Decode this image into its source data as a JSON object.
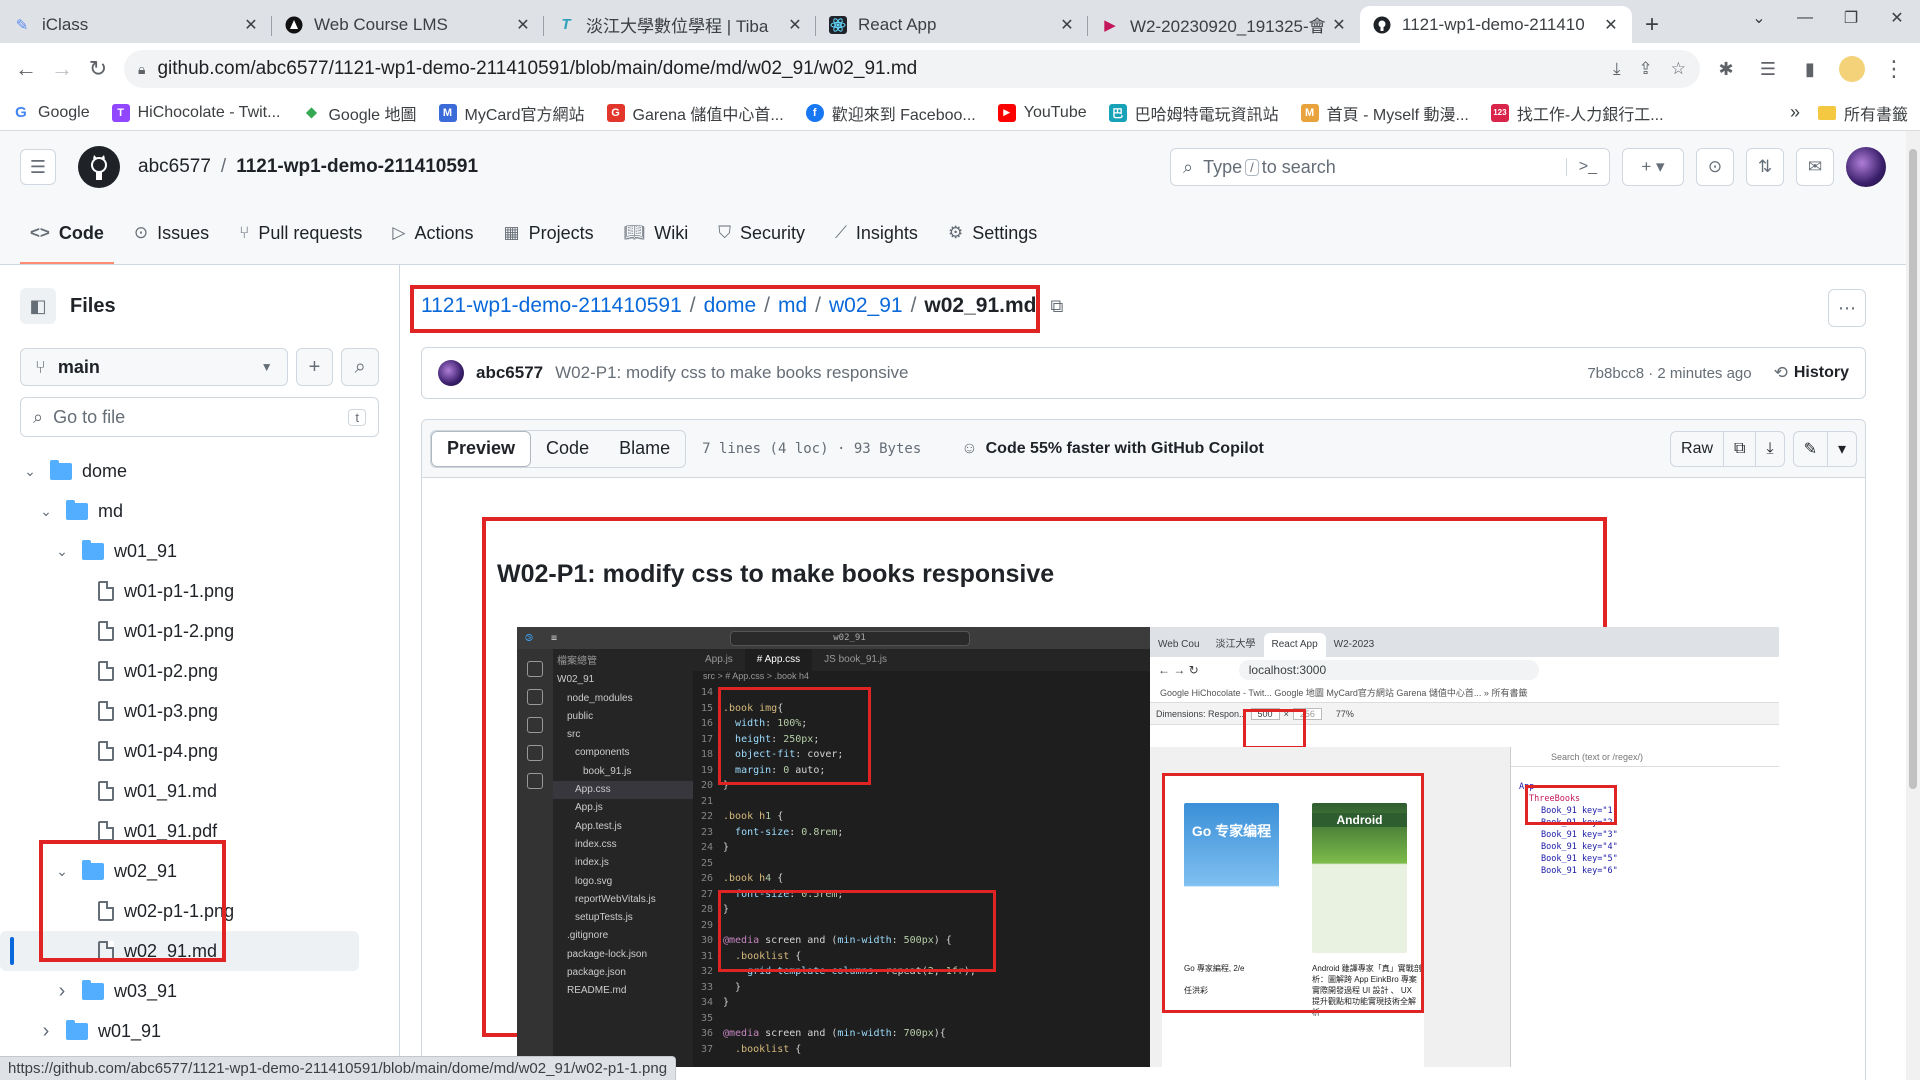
{
  "browser": {
    "tabs": [
      {
        "title": "iClass",
        "icon": "iclass-icon"
      },
      {
        "title": "Web Course LMS",
        "icon": "lms-icon"
      },
      {
        "title": "淡江大學數位學程 | Tiba",
        "icon": "tiba-icon"
      },
      {
        "title": "React App",
        "icon": "react-icon"
      },
      {
        "title": "W2-20230920_191325-會",
        "icon": "video-icon"
      },
      {
        "title": "1121-wp1-demo-211410",
        "icon": "github-icon"
      }
    ],
    "url": "github.com/abc6577/1121-wp1-demo-211410591/blob/main/dome/md/w02_91/w02_91.md",
    "bookmarks": [
      {
        "label": "Google",
        "color": "#4285f4",
        "glyph": "G"
      },
      {
        "label": "HiChocolate - Twit...",
        "color": "#9146ff",
        "glyph": "T"
      },
      {
        "label": "Google 地圖",
        "color": "#34a853",
        "glyph": "◆"
      },
      {
        "label": "MyCard官方網站",
        "color": "#3b6bd8",
        "glyph": "M"
      },
      {
        "label": "Garena 儲值中心首...",
        "color": "#e2352b",
        "glyph": "G"
      },
      {
        "label": "歡迎來到 Faceboo...",
        "color": "#1877f2",
        "glyph": "f"
      },
      {
        "label": "YouTube",
        "color": "#ff0000",
        "glyph": "▶"
      },
      {
        "label": "巴哈姆特電玩資訊站",
        "color": "#18a2b8",
        "glyph": "巴"
      },
      {
        "label": "首頁 - Myself 動漫...",
        "color": "#e8a33c",
        "glyph": "M"
      },
      {
        "label": "找工作-人力銀行工...",
        "color": "#d9254a",
        "glyph": "123"
      }
    ],
    "bookmarks_all": "所有書籤",
    "status_url": "https://github.com/abc6577/1121-wp1-demo-211410591/blob/main/dome/md/w02_91/w02-p1-1.png"
  },
  "github": {
    "owner": "abc6577",
    "repo": "1121-wp1-demo-211410591",
    "search_placeholder": "Type / to search",
    "search_prefix": "Type",
    "search_slash": "/",
    "search_suffix": "to search",
    "nav": [
      "Code",
      "Issues",
      "Pull requests",
      "Actions",
      "Projects",
      "Wiki",
      "Security",
      "Insights",
      "Settings"
    ],
    "files_title": "Files",
    "branch": "main",
    "goto_placeholder": "Go to file",
    "goto_key": "t",
    "tree": [
      {
        "label": "dome",
        "type": "folder",
        "depth": 0,
        "open": true
      },
      {
        "label": "md",
        "type": "folder",
        "depth": 1,
        "open": true
      },
      {
        "label": "w01_91",
        "type": "folder",
        "depth": 2,
        "open": true
      },
      {
        "label": "w01-p1-1.png",
        "type": "file",
        "depth": 3
      },
      {
        "label": "w01-p1-2.png",
        "type": "file",
        "depth": 3
      },
      {
        "label": "w01-p2.png",
        "type": "file",
        "depth": 3
      },
      {
        "label": "w01-p3.png",
        "type": "file",
        "depth": 3
      },
      {
        "label": "w01-p4.png",
        "type": "file",
        "depth": 3
      },
      {
        "label": "w01_91.md",
        "type": "file",
        "depth": 3
      },
      {
        "label": "w01_91.pdf",
        "type": "file",
        "depth": 3
      },
      {
        "label": "w02_91",
        "type": "folder",
        "depth": 2,
        "open": true
      },
      {
        "label": "w02-p1-1.png",
        "type": "file",
        "depth": 3
      },
      {
        "label": "w02_91.md",
        "type": "file",
        "depth": 3,
        "selected": true
      },
      {
        "label": "w03_91",
        "type": "folder",
        "depth": 2,
        "open": false
      },
      {
        "label": "w01_91",
        "type": "folder",
        "depth": 1,
        "open": false
      }
    ],
    "path": {
      "repo": "1121-wp1-demo-211410591",
      "parts": [
        "dome",
        "md",
        "w02_91"
      ],
      "file": "w02_91.md"
    },
    "commit": {
      "author": "abc6577",
      "message": "W02-P1: modify css to make books responsive",
      "sha_time": "7b8bcc8 · 2 minutes ago",
      "history": "History"
    },
    "file_header": {
      "tabs": [
        "Preview",
        "Code",
        "Blame"
      ],
      "meta": "7 lines (4 loc) · 93 Bytes",
      "copilot": "Code 55% faster with GitHub Copilot",
      "raw": "Raw"
    },
    "md_title": "W02-P1: modify css to make books responsive"
  },
  "embedded": {
    "vscode_search": "w02_91",
    "explorer": [
      "檔案總管",
      "W02_91",
      "node_modules",
      "public",
      "src",
      "components",
      "book_91.js",
      "App.css",
      "App.js",
      "App.test.js",
      "index.css",
      "index.js",
      "logo.svg",
      "reportWebVitals.js",
      "setupTests.js",
      ".gitignore",
      "package-lock.json",
      "package.json",
      "README.md"
    ],
    "editor_tabs": [
      "App.js",
      "# App.css",
      "JS book_91.js"
    ],
    "editor_crumb": "src > # App.css > .book h4",
    "code": [
      {
        "n": "14",
        "t": ""
      },
      {
        "n": "15",
        "t": ".book img{"
      },
      {
        "n": "16",
        "t": "  width: 100%;"
      },
      {
        "n": "17",
        "t": "  height: 250px;"
      },
      {
        "n": "18",
        "t": "  object-fit: cover;"
      },
      {
        "n": "19",
        "t": "  margin: 0 auto;"
      },
      {
        "n": "20",
        "t": "}"
      },
      {
        "n": "21",
        "t": ""
      },
      {
        "n": "22",
        "t": ".book h1 {"
      },
      {
        "n": "23",
        "t": "  font-size: 0.8rem;"
      },
      {
        "n": "24",
        "t": "}"
      },
      {
        "n": "25",
        "t": ""
      },
      {
        "n": "26",
        "t": ".book h4 {"
      },
      {
        "n": "27",
        "t": "  font-size: 0.5rem;"
      },
      {
        "n": "28",
        "t": "}"
      },
      {
        "n": "29",
        "t": ""
      },
      {
        "n": "30",
        "t": "@media screen and (min-width: 500px) {"
      },
      {
        "n": "31",
        "t": "  .booklist {"
      },
      {
        "n": "32",
        "t": "    grid-template-columns: repeat(2, 1fr);"
      },
      {
        "n": "33",
        "t": "  }"
      },
      {
        "n": "34",
        "t": "}"
      },
      {
        "n": "35",
        "t": ""
      },
      {
        "n": "36",
        "t": "@media screen and (min-width: 700px){"
      },
      {
        "n": "37",
        "t": "  .booklist {"
      }
    ],
    "browser_tabs": [
      "Web Cou",
      "淡江大學",
      "React App",
      "W2-2023"
    ],
    "browser_url": "localhost:3000",
    "browser_bookmarks": "Google   HiChocolate - Twit...   Google 地圖   MyCard官方網站   Garena 儲值中心首...   »   所有書籤",
    "dimensions_label": "Dimensions: Respon...",
    "width": "500",
    "height": "256",
    "zoom": "77%",
    "devtools_search": "Search (text or /regex/)",
    "devtools_app": "App",
    "devtools_nodes": [
      "ThreeBooks",
      "Book_91 key=\"1\"",
      "Book_91 key=\"2\"",
      "Book_91 key=\"3\"",
      "Book_91 key=\"4\"",
      "Book_91 key=\"5\"",
      "Book_91 key=\"6\""
    ],
    "book1_cover": "Go 专家编程",
    "book1_caption": "Go 專家編程, 2/e",
    "book1_author": "任洪彩",
    "book2_cover": "Android",
    "book2_caption": "Android 雖譯專家「真」實戰剖析：圖解跨 App EinkBro 專案 實際開發過程 UI 設計 、 UX 提升觀點和功能實現技術全解析"
  }
}
